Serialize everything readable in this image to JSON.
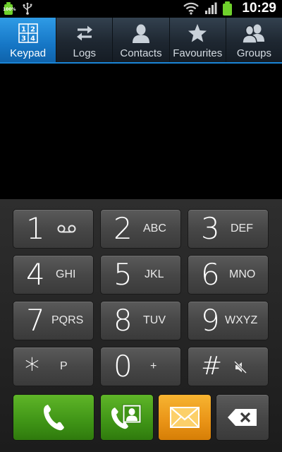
{
  "status_bar": {
    "battery_small_label": "100%",
    "time": "10:29",
    "icons": [
      "battery-icon",
      "usb-icon",
      "wifi-icon",
      "signal-icon",
      "battery-icon"
    ]
  },
  "tabs": [
    {
      "label": "Keypad",
      "icon": "keypad-icon",
      "active": true
    },
    {
      "label": "Logs",
      "icon": "swap-arrows-icon",
      "active": false
    },
    {
      "label": "Contacts",
      "icon": "person-icon",
      "active": false
    },
    {
      "label": "Favourites",
      "icon": "star-icon",
      "active": false
    },
    {
      "label": "Groups",
      "icon": "group-icon",
      "active": false
    }
  ],
  "keypad_icon_digits": [
    "1",
    "2",
    "3",
    "4"
  ],
  "keys": [
    {
      "digit": "1",
      "sub": "",
      "sub_icon": "voicemail-icon"
    },
    {
      "digit": "2",
      "sub": "ABC"
    },
    {
      "digit": "3",
      "sub": "DEF"
    },
    {
      "digit": "4",
      "sub": "GHI"
    },
    {
      "digit": "5",
      "sub": "JKL"
    },
    {
      "digit": "6",
      "sub": "MNO"
    },
    {
      "digit": "7",
      "sub": "PQRS"
    },
    {
      "digit": "8",
      "sub": "TUV"
    },
    {
      "digit": "9",
      "sub": "WXYZ"
    },
    {
      "digit": "*",
      "sub": "P"
    },
    {
      "digit": "0",
      "sub": "+"
    },
    {
      "digit": "#",
      "sub": "",
      "sub_icon": "mute-icon"
    }
  ],
  "actions": [
    {
      "name": "call-button",
      "icon": "phone-icon"
    },
    {
      "name": "video-call-button",
      "icon": "video-call-icon"
    },
    {
      "name": "message-button",
      "icon": "envelope-icon"
    },
    {
      "name": "delete-button",
      "icon": "backspace-icon"
    }
  ],
  "colors": {
    "tab_active": "#1e88d8",
    "call_green": "#45991a",
    "message_orange": "#ee9a1d",
    "battery_green": "#6fd12c"
  }
}
